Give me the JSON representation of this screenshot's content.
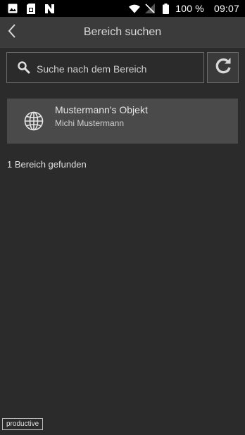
{
  "status_bar": {
    "battery_text": "100 %",
    "time": "09:07",
    "icons": [
      "image-icon",
      "sim-card-icon",
      "nfc-icon",
      "wifi-icon",
      "no-signal-icon",
      "battery-icon"
    ]
  },
  "appbar": {
    "title": "Bereich suchen",
    "back_icon": "chevron-left-icon"
  },
  "search": {
    "placeholder": "Suche nach dem Bereich",
    "value": "",
    "icon": "search-icon"
  },
  "refresh": {
    "icon": "refresh-icon"
  },
  "results": {
    "items": [
      {
        "title": "Mustermann's Objekt",
        "subtitle": "Michi Mustermann",
        "icon": "globe-icon"
      }
    ],
    "count_text": "1 Bereich gefunden"
  },
  "env_badge": "productive",
  "colors": {
    "background": "#2b2b2b",
    "appbar": "#3b3b3b",
    "card": "#4a4a4a",
    "border": "#6a6a6a",
    "text": "#e6e6e6"
  }
}
